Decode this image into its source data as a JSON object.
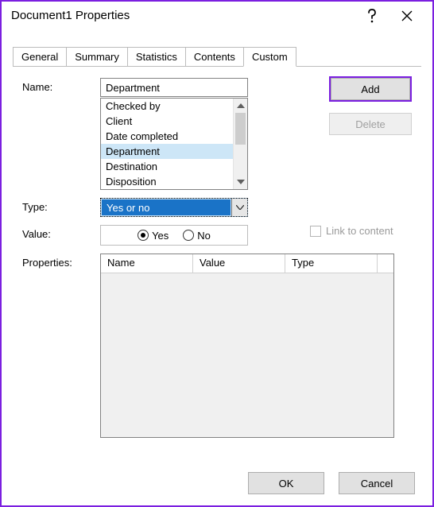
{
  "title": "Document1 Properties",
  "tabs": [
    "General",
    "Summary",
    "Statistics",
    "Contents",
    "Custom"
  ],
  "active_tab": 4,
  "labels": {
    "name": "Name:",
    "type": "Type:",
    "value": "Value:",
    "properties": "Properties:",
    "link_to_content": "Link to content"
  },
  "name_field": {
    "value": "Department",
    "options": [
      "Checked by",
      "Client",
      "Date completed",
      "Department",
      "Destination",
      "Disposition"
    ],
    "selected_index": 3
  },
  "buttons": {
    "add": "Add",
    "delete": "Delete",
    "ok": "OK",
    "cancel": "Cancel"
  },
  "type_combo": {
    "value": "Yes or no"
  },
  "value_radio": {
    "options": [
      "Yes",
      "No"
    ],
    "selected_index": 0
  },
  "link_to_content_enabled": false,
  "properties_grid": {
    "columns": [
      "Name",
      "Value",
      "Type"
    ],
    "rows": []
  },
  "colors": {
    "highlight": "#7b1fe0",
    "list_selection": "#cde6f7",
    "combo_bg": "#c7e0f4",
    "combo_sel": "#1a73c7"
  }
}
